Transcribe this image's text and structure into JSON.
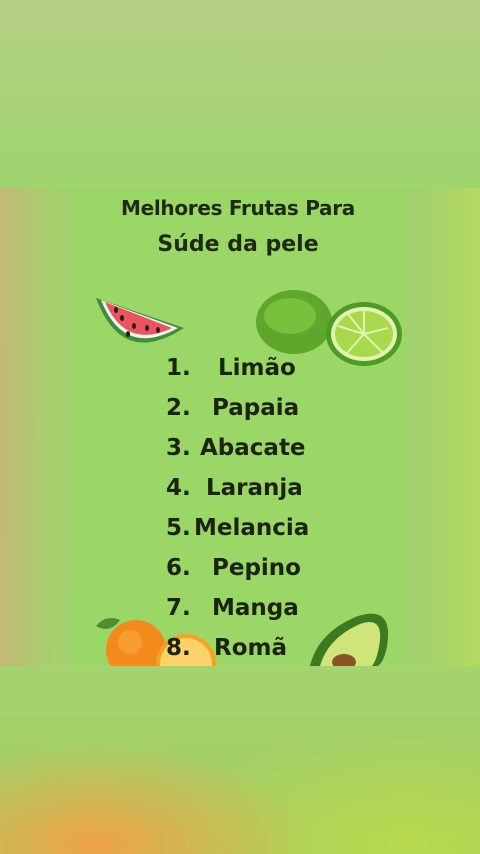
{
  "card": {
    "title_line1": "Melhores Frutas Para",
    "title_line2": "Súde da pele"
  },
  "fruits": [
    {
      "number": "1.",
      "name": "Limão"
    },
    {
      "number": "2.",
      "name": "Papaia"
    },
    {
      "number": "3.",
      "name": "Abacate"
    },
    {
      "number": "4.",
      "name": "Laranja"
    },
    {
      "number": "5.",
      "name": "Melancia"
    },
    {
      "number": "6.",
      "name": "Pepino"
    },
    {
      "number": "7.",
      "name": "Manga"
    },
    {
      "number": "8.",
      "name": "Romã"
    }
  ],
  "illustrations": [
    "watermelon-icon",
    "lime-icon",
    "orange-icon",
    "avocado-icon"
  ],
  "colors": {
    "card_background": "#9bd767",
    "text": "#1a2410"
  }
}
